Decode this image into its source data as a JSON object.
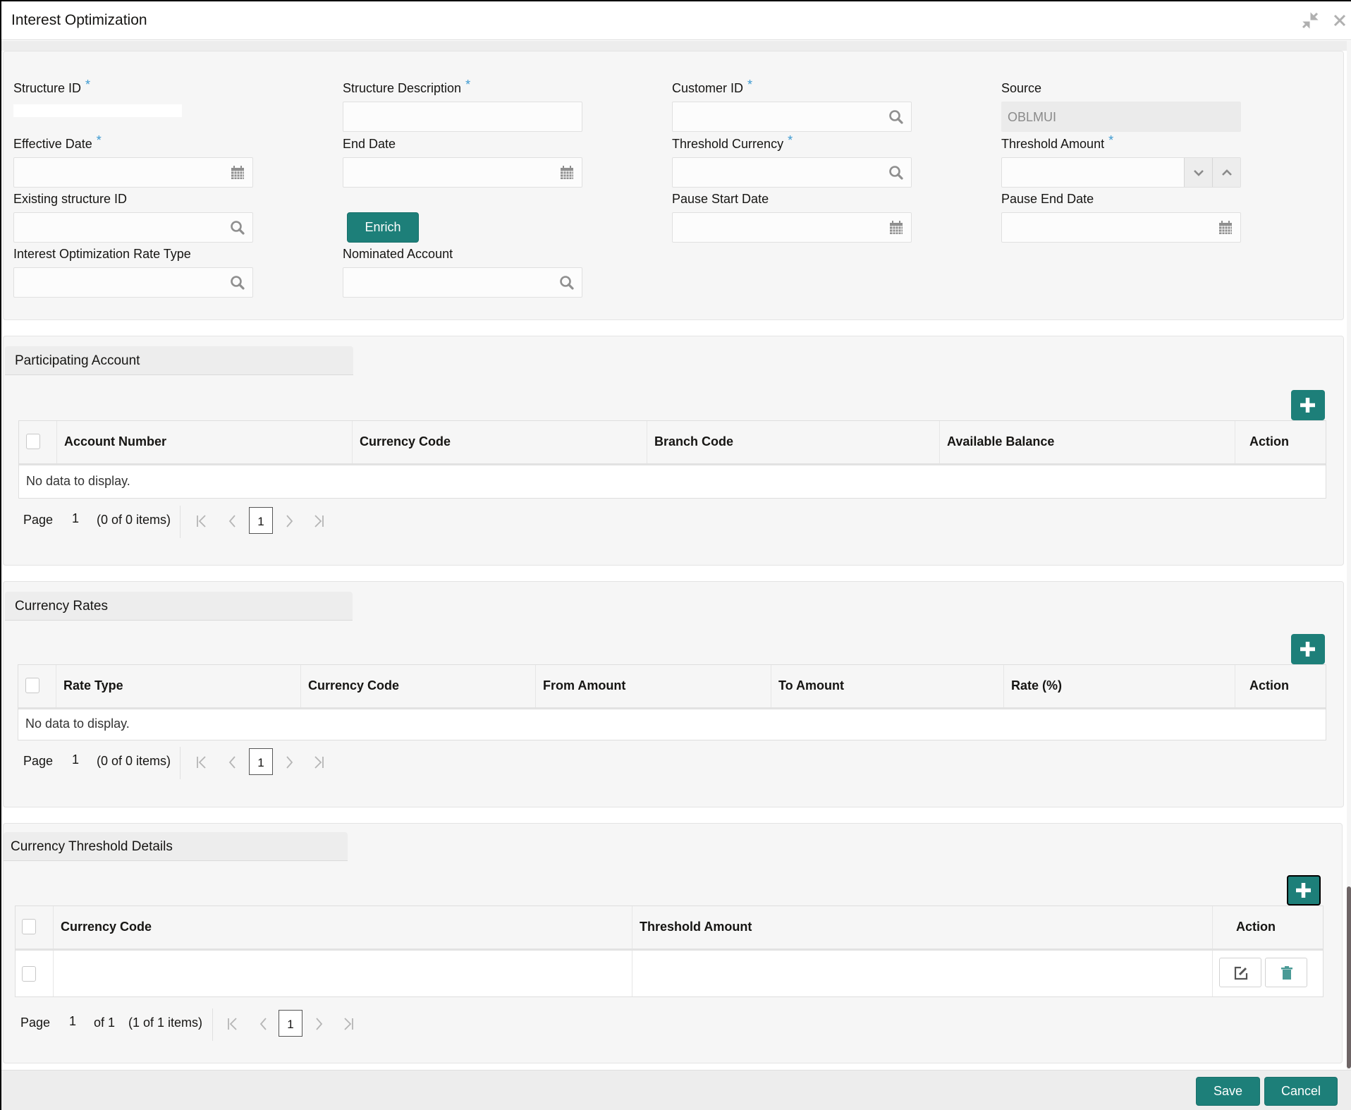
{
  "window": {
    "title": "Interest Optimization",
    "minimize_icon": "collapse-arrows-icon",
    "close_icon": "close-icon"
  },
  "form": {
    "required_marker": "*",
    "structure_id": {
      "label": "Structure ID",
      "value": ""
    },
    "structure_description": {
      "label": "Structure Description",
      "value": ""
    },
    "customer_id": {
      "label": "Customer ID",
      "value": "",
      "icon": "search-icon"
    },
    "source": {
      "label": "Source",
      "value": "OBLMUI"
    },
    "effective_date": {
      "label": "Effective Date",
      "value": "",
      "icon": "calendar-icon"
    },
    "end_date": {
      "label": "End Date",
      "value": "",
      "icon": "calendar-icon"
    },
    "threshold_currency": {
      "label": "Threshold Currency",
      "value": "",
      "icon": "search-icon"
    },
    "threshold_amount": {
      "label": "Threshold Amount",
      "value": ""
    },
    "existing_structure_id": {
      "label": "Existing structure ID",
      "value": "",
      "icon": "search-icon"
    },
    "enrich_button": "Enrich",
    "pause_start_date": {
      "label": "Pause Start Date",
      "value": "",
      "icon": "calendar-icon"
    },
    "pause_end_date": {
      "label": "Pause End Date",
      "value": "",
      "icon": "calendar-icon"
    },
    "rate_type": {
      "label": "Interest Optimization Rate Type",
      "value": "",
      "icon": "search-icon"
    },
    "nominated_account": {
      "label": "Nominated Account",
      "value": "",
      "icon": "search-icon"
    }
  },
  "participating_account": {
    "title": "Participating Account",
    "columns": [
      "Account Number",
      "Currency Code",
      "Branch Code",
      "Available Balance",
      "Action"
    ],
    "rows": [],
    "empty_text": "No data to display.",
    "pager": {
      "page_label": "Page",
      "page": "1",
      "summary": "(0 of 0 items)",
      "current": "1"
    }
  },
  "currency_rates": {
    "title": "Currency Rates",
    "columns": [
      "Rate Type",
      "Currency Code",
      "From Amount",
      "To Amount",
      "Rate (%)",
      "Action"
    ],
    "rows": [],
    "empty_text": "No data to display.",
    "pager": {
      "page_label": "Page",
      "page": "1",
      "summary": "(0 of 0 items)",
      "current": "1"
    }
  },
  "currency_threshold": {
    "title": "Currency Threshold Details",
    "columns": [
      "Currency Code",
      "Threshold Amount",
      "Action"
    ],
    "rows": [
      {
        "currency_code": "",
        "threshold_amount": "",
        "actions": [
          "edit-icon",
          "delete-icon"
        ]
      }
    ],
    "pager": {
      "page_label": "Page",
      "page": "1",
      "of_pages": "of 1",
      "summary": "(1 of 1 items)",
      "current": "1"
    }
  },
  "footer": {
    "save": "Save",
    "cancel": "Cancel"
  },
  "colors": {
    "accent": "#1d7f79",
    "required": "#3d9ad1",
    "section_bg": "#f6f6f6",
    "tab_bg": "#ededed"
  }
}
